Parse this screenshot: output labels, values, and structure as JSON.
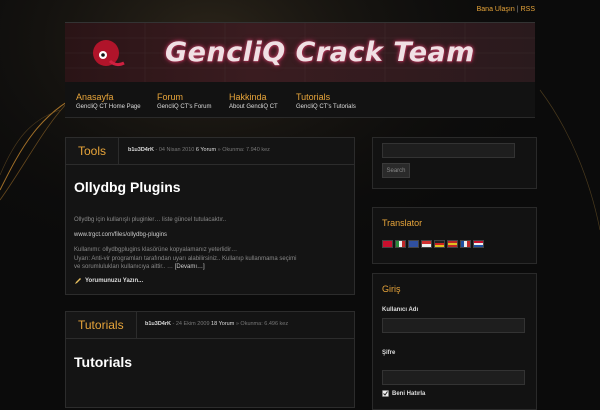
{
  "toplinks": {
    "contact": "Bana Ulaşın",
    "separator": "|",
    "rss": "RSS"
  },
  "banner": {
    "title": "GencliQ Crack Team"
  },
  "nav": [
    {
      "label": "Anasayfa",
      "sub": "GencliQ CT Home Page"
    },
    {
      "label": "Forum",
      "sub": "GencliQ CT's Forum"
    },
    {
      "label": "Hakkinda",
      "sub": "About GencliQ CT"
    },
    {
      "label": "Tutorials",
      "sub": "GencliQ CT's Tutorials"
    }
  ],
  "posts": [
    {
      "category": "Tools",
      "author": "b1u3D4rK",
      "date": "- 04 Nisan 2010",
      "comments": "6 Yorum",
      "views": "» Okunma: 7.940 kez",
      "title": "Ollydbg Plugins",
      "excerpt": "Ollydbg için kullanışlı pluginler… liste güncel tutulacaktır..",
      "link": "www.trgct.com/files/ollydbg-plugins",
      "body1": "Kullanımı: ollydbgplugins klasörüne kopyalamanız yeterlidir…",
      "body2": "Uyarı: Anti-vir programları tarafından uyarı alabilirsiniz.. Kullanıp kullanmama seçimi",
      "body3": "ve sorumlulukları kullanıcıya aittir..  …",
      "more": "[Devamı…]",
      "write_comment": "Yorumunuzu Yazın..."
    },
    {
      "category": "Tutorials",
      "author": "b1u3D4rK",
      "date": "- 24 Ekim 2009",
      "comments": "18 Yorum",
      "views": "» Okunma: 6.496 kez",
      "title": "Tutorials"
    }
  ],
  "sidebar": {
    "search_button": "Search",
    "translator_title": "Translator",
    "login_title": "Giriş",
    "username_label": "Kullanıcı Adı",
    "password_label": "Şifre",
    "remember_label": "Beni Hatırla"
  },
  "flags": [
    "#c8102e",
    "#2a8a3a",
    "#3050a0",
    "#d03030",
    "#e0c020",
    "#c02828",
    "#2050a0",
    "#c8102e"
  ]
}
